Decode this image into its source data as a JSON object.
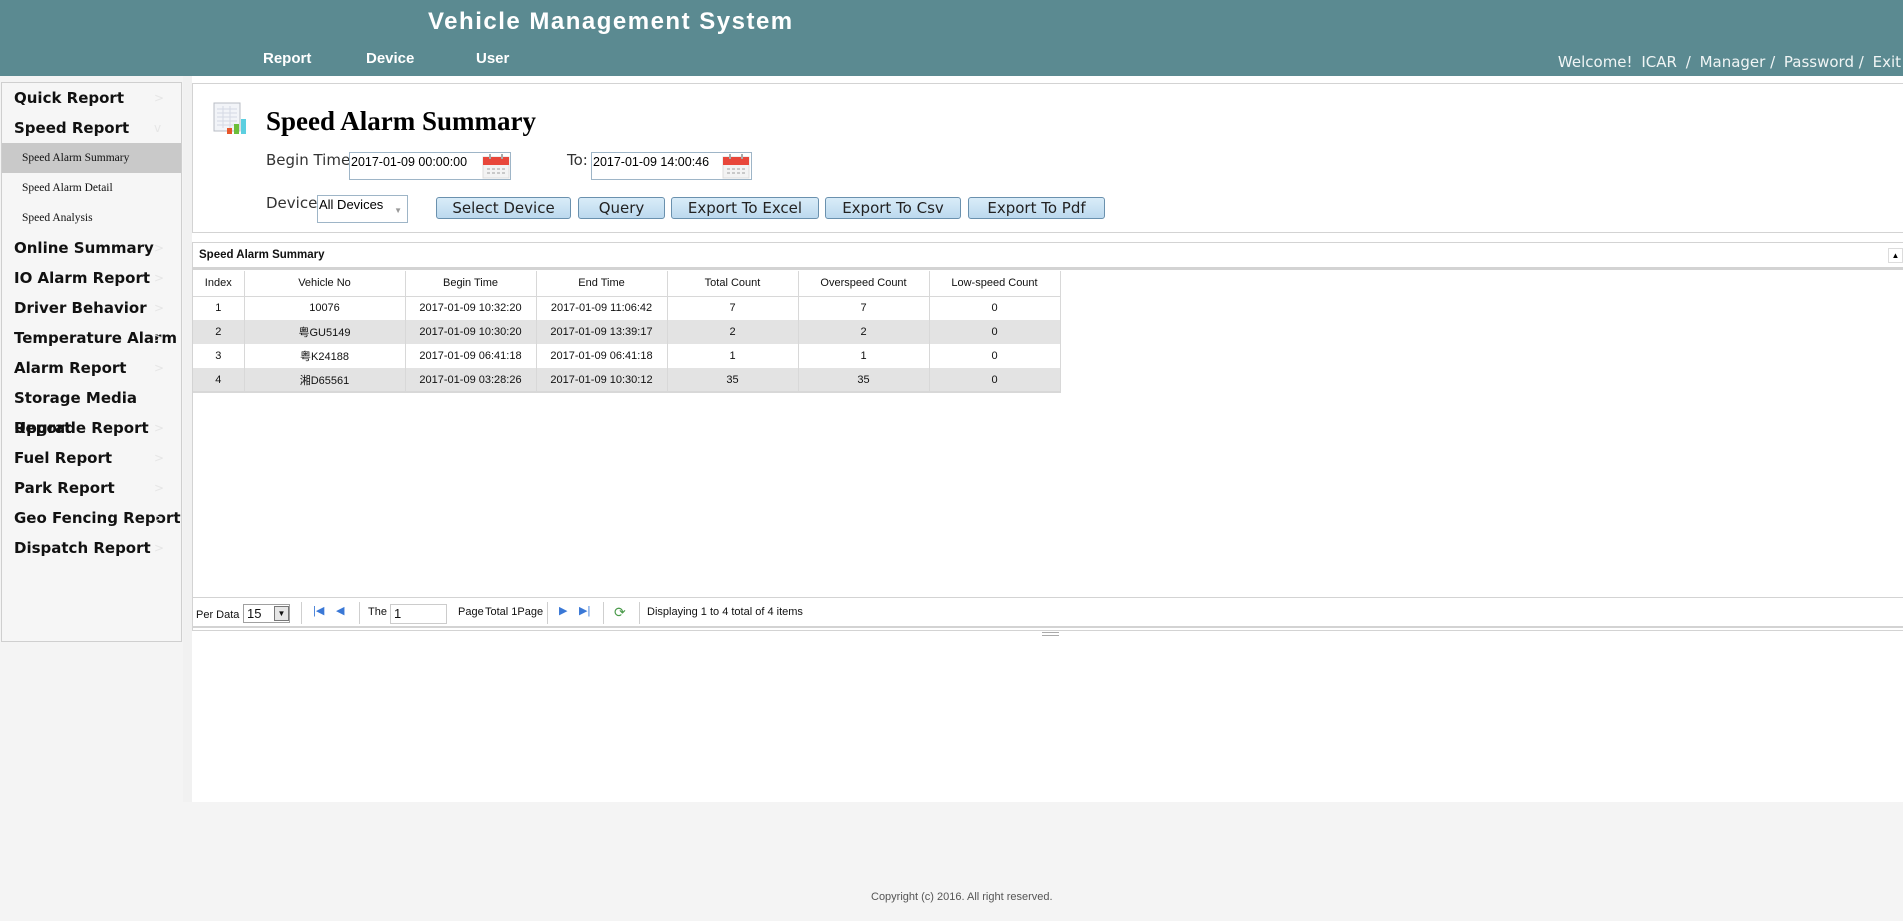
{
  "header": {
    "title": "Vehicle Management System",
    "nav": [
      "Report",
      "Device",
      "User"
    ],
    "welcome": "Welcome!",
    "user": "ICAR",
    "role": "Manager /",
    "password": "Password /",
    "exit": "Exit",
    "slash": "/"
  },
  "sidebar": {
    "items": [
      {
        "label": "Quick Report"
      },
      {
        "label": "Speed Report",
        "children": [
          "Speed Alarm Summary",
          "Speed Alarm Detail",
          "Speed Analysis"
        ],
        "active_child": "Speed Alarm Summary"
      },
      {
        "label": "Online Summary"
      },
      {
        "label": "IO Alarm Report"
      },
      {
        "label": "Driver Behavior"
      },
      {
        "label": "Temperature Alarm"
      },
      {
        "label": "Alarm Report"
      },
      {
        "label": "Storage Media Report"
      },
      {
        "label": "Upgrade Report"
      },
      {
        "label": "Fuel Report"
      },
      {
        "label": "Park Report"
      },
      {
        "label": "Geo Fencing Report"
      },
      {
        "label": "Dispatch Report"
      }
    ]
  },
  "filters": {
    "title": "Speed Alarm Summary",
    "begin_label": "Begin Time:",
    "begin_value": "2017-01-09 00:00:00",
    "to_label": "To:",
    "to_value": "2017-01-09 14:00:46",
    "device_label": "Device:",
    "device_value": "All Devices",
    "buttons": [
      "Select Device",
      "Query",
      "Export To Excel",
      "Export To Csv",
      "Export To Pdf"
    ]
  },
  "grid": {
    "title": "Speed Alarm Summary",
    "columns": [
      "Index",
      "Vehicle No",
      "Begin Time",
      "End Time",
      "Total Count",
      "Overspeed Count",
      "Low-speed Count"
    ],
    "rows": [
      [
        "1",
        "10076",
        "2017-01-09 10:32:20",
        "2017-01-09 11:06:42",
        "7",
        "7",
        "0"
      ],
      [
        "2",
        "粤GU5149",
        "2017-01-09 10:30:20",
        "2017-01-09 13:39:17",
        "2",
        "2",
        "0"
      ],
      [
        "3",
        "粤K24188",
        "2017-01-09 06:41:18",
        "2017-01-09 06:41:18",
        "1",
        "1",
        "0"
      ],
      [
        "4",
        "湘D65561",
        "2017-01-09 03:28:26",
        "2017-01-09 10:30:12",
        "35",
        "35",
        "0"
      ]
    ]
  },
  "pager": {
    "per_label": "Per Data",
    "per_value": "15",
    "the_label": "The",
    "page_value": "1",
    "page_label": "Page",
    "total_label": "Total 1Page",
    "status": "Displaying 1 to 4 total of 4 items"
  },
  "footer": {
    "copyright": "Copyright (c) 2016. All right reserved."
  },
  "colors": {
    "header_bg": "#5b8a91",
    "button_bg": "#c8e1f3",
    "active_sidebar": "#c9c9c9"
  }
}
